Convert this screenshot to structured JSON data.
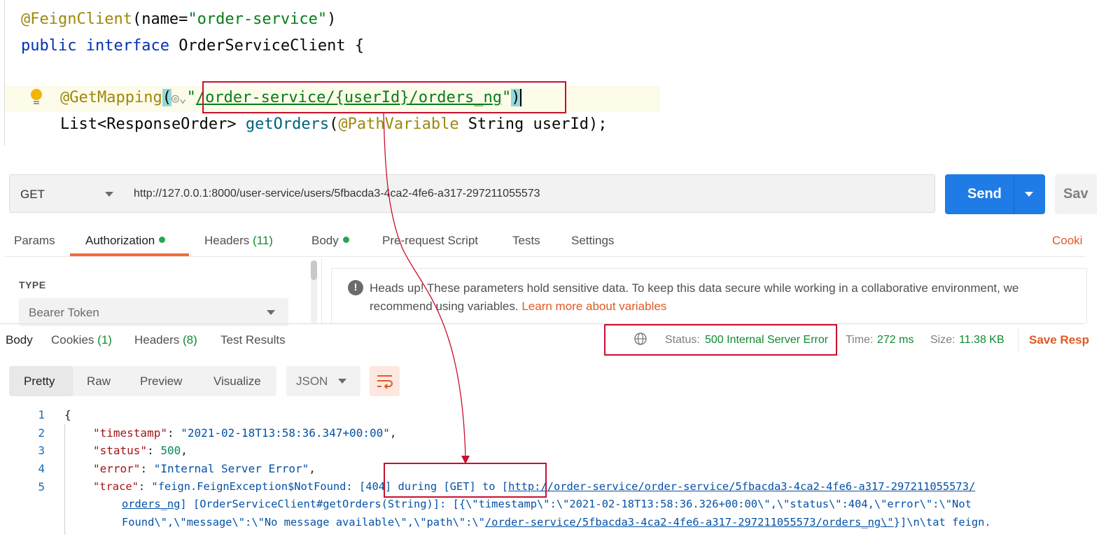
{
  "editor": {
    "line1_ann": "@FeignClient",
    "line1_open": "(name=",
    "line1_str": "\"order-service\"",
    "line1_close": ")",
    "line2_kw1": "public",
    "line2_kw2": "interface",
    "line2_rest": "OrderServiceClient {",
    "line4_ann": "@GetMapping",
    "line4_open": "(",
    "line4_globe": "◎⌄",
    "line4_q1": "\"",
    "line4_path": "/order-service/{userId}/orders_ng",
    "line4_q2": "\"",
    "line4_close": ")",
    "line5_type": "List<ResponseOrder> ",
    "line5_fn": "getOrders",
    "line5_open": "(",
    "line5_ann": "@PathVariable",
    "line5_rest": " String userId);"
  },
  "request": {
    "method": "GET",
    "url": "http://127.0.0.1:8000/user-service/users/5fbacda3-4ca2-4fe6-a317-297211055573",
    "send_label": "Send",
    "save_label": "Sav"
  },
  "request_tabs": {
    "params": "Params",
    "authorization": "Authorization",
    "headers": "Headers",
    "headers_count": "(11)",
    "body": "Body",
    "prerequest": "Pre-request Script",
    "tests": "Tests",
    "settings": "Settings",
    "cookies": "Cooki"
  },
  "auth": {
    "type_label": "TYPE",
    "type_value": "Bearer Token",
    "notice": "Heads up! These parameters hold sensitive data. To keep this data secure while working in a collaborative environment, we recommend using variables.",
    "notice_link": "Learn more about variables"
  },
  "response_tabs": {
    "body": "Body",
    "cookies": "Cookies",
    "cookies_count": "(1)",
    "headers": "Headers",
    "headers_count": "(8)",
    "test_results": "Test Results"
  },
  "response_meta": {
    "status_label": "Status:",
    "status_value": "500 Internal Server Error",
    "time_label": "Time:",
    "time_value": "272 ms",
    "size_label": "Size:",
    "size_value": "11.38 KB",
    "save_response": "Save Resp"
  },
  "view_modes": {
    "pretty": "Pretty",
    "raw": "Raw",
    "preview": "Preview",
    "visualize": "Visualize",
    "format": "JSON"
  },
  "json_body": {
    "line_numbers": [
      "1",
      "2",
      "3",
      "4",
      "5"
    ],
    "l1": "{",
    "l2_key": "\"timestamp\"",
    "l2_sep": ": ",
    "l2_val": "\"2021-02-18T13:58:36.347+00:00\"",
    "l2_end": ",",
    "l3_key": "\"status\"",
    "l3_sep": ": ",
    "l3_val": "500",
    "l3_end": ",",
    "l4_key": "\"error\"",
    "l4_sep": ": ",
    "l4_val": "\"Internal Server Error\"",
    "l4_end": ",",
    "l5_key": "\"trace\"",
    "l5_sep": ": ",
    "l5_a": "\"feign.FeignException$NotFound: ",
    "l5_b": "[404] during [GET] to ",
    "l5_c": "[",
    "l5_link1": "http://order-service/order-service/5fbacda3-4ca2-4fe6-a317-297211055573/",
    "l6_link": "orders_ng",
    "l6_rest": "] [OrderServiceClient#getOrders(String)]: [{\\\"timestamp\\\":\\\"2021-02-18T13:58:36.326+00:00\\\",\\\"status\\\":404,\\\"error\\\":\\\"Not",
    "l7_a": "Found\\\",\\\"message\\\":\\\"No message available\\\",\\\"path\\\":\\\"",
    "l7_link": "/order-service/5fbacda3-4ca2-4fe6-a317-297211055573/orders_ng\\\"",
    "l7_b": "}]\\n\\tat feign."
  },
  "colors": {
    "annotation_box": "#c8102e",
    "send_button": "#1f7be5",
    "accent_orange": "#e05a26",
    "status_green": "#0f8b30"
  }
}
